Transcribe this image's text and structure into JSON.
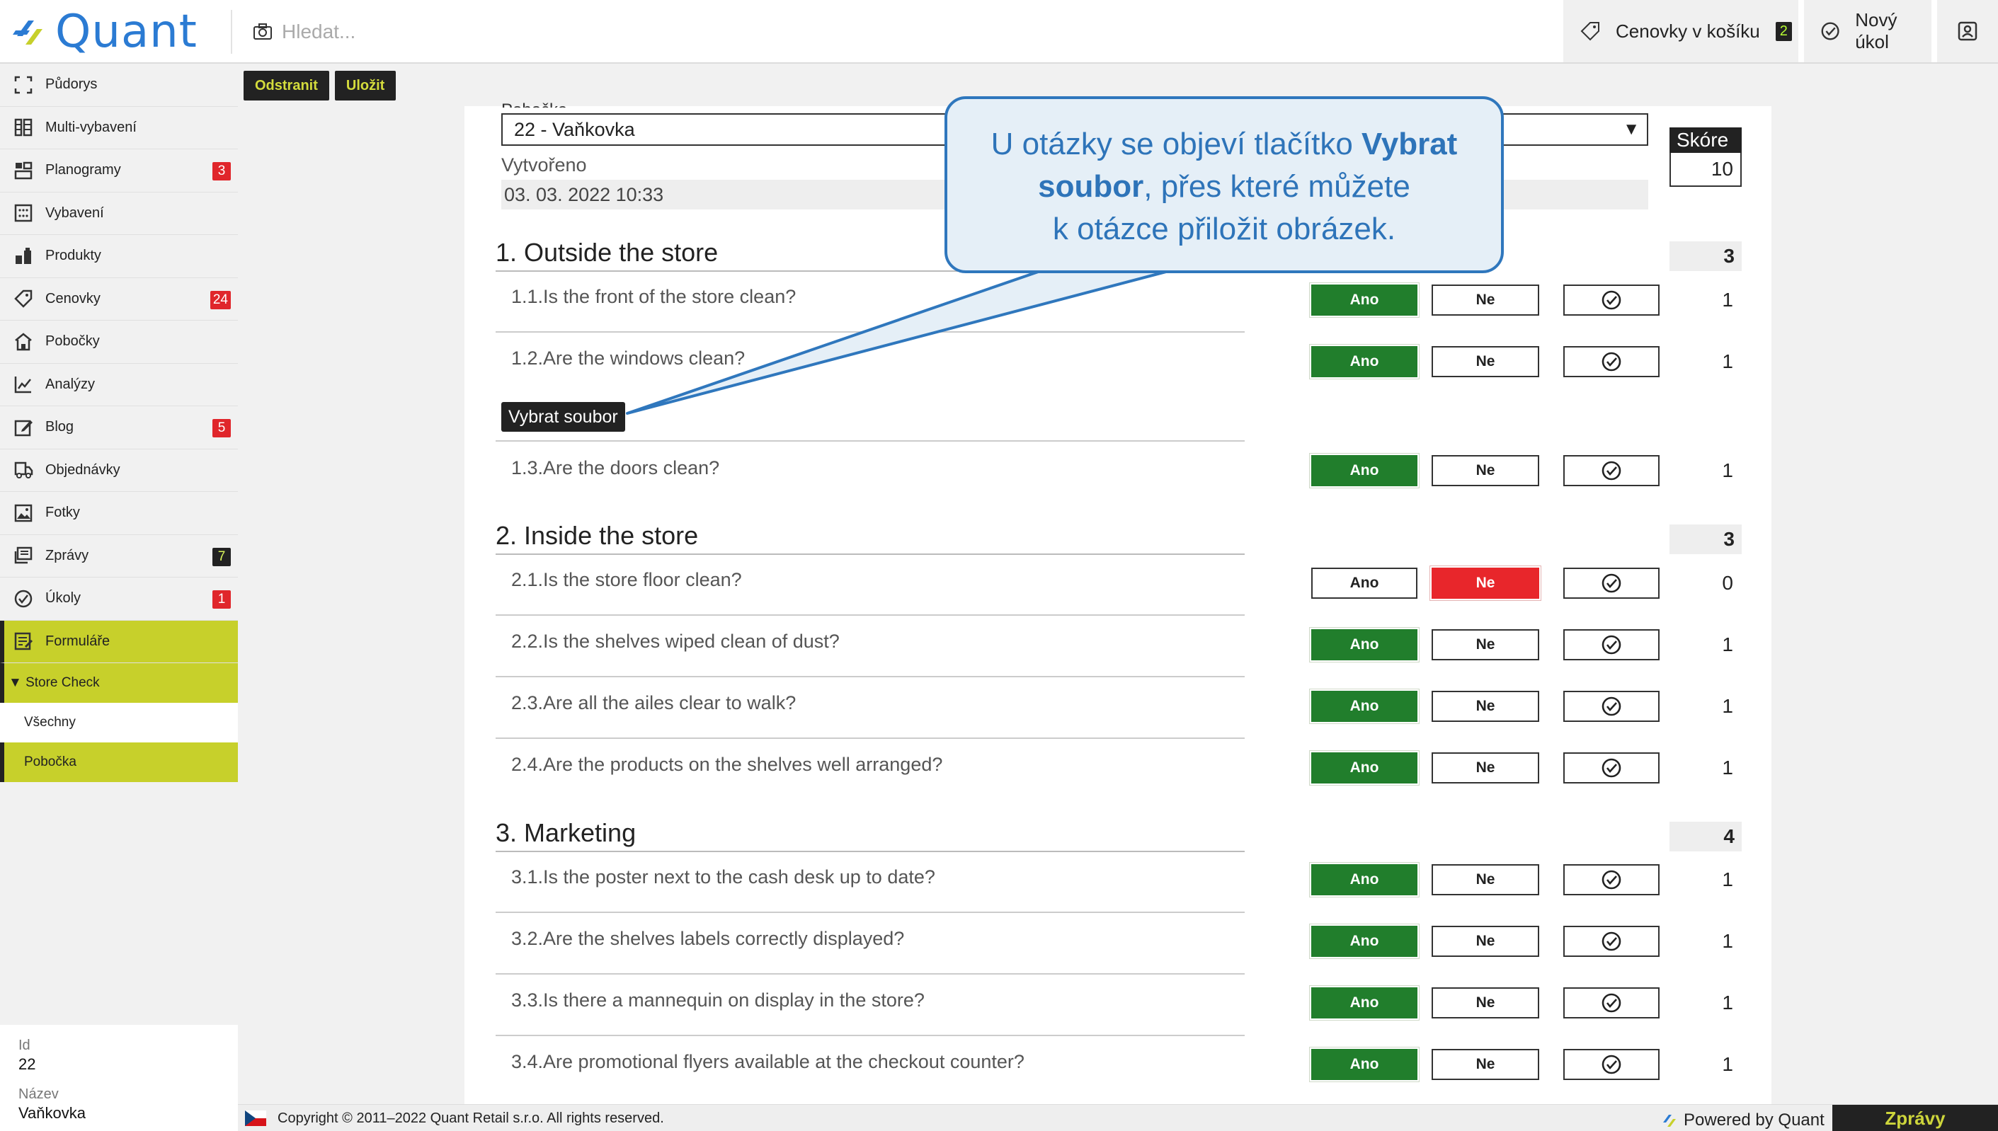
{
  "app": {
    "brand": "Quant",
    "brand_color": "#2b7bd3",
    "search_placeholder": "Hledat...",
    "top_buttons": [
      {
        "label": "Cenovky v košíku",
        "badge": "2",
        "icon": "tag-icon"
      },
      {
        "label": "Nový úkol",
        "icon": "check-circle-icon"
      },
      {
        "icon": "user-icon"
      }
    ]
  },
  "sidebar": {
    "items": [
      {
        "label": "Půdorys",
        "icon": "floorplan-icon"
      },
      {
        "label": "Multi-vybavení",
        "icon": "shelves-icon"
      },
      {
        "label": "Planogramy",
        "icon": "planogram-icon",
        "badge": "3"
      },
      {
        "label": "Vybavení",
        "icon": "grid-icon"
      },
      {
        "label": "Produkty",
        "icon": "products-icon"
      },
      {
        "label": "Cenovky",
        "icon": "tag-icon",
        "badge": "24"
      },
      {
        "label": "Pobočky",
        "icon": "store-icon"
      },
      {
        "label": "Analýzy",
        "icon": "chart-icon"
      },
      {
        "label": "Blog",
        "icon": "edit-icon",
        "badge": "5"
      },
      {
        "label": "Objednávky",
        "icon": "truck-icon"
      },
      {
        "label": "Fotky",
        "icon": "image-icon"
      },
      {
        "label": "Zprávy",
        "icon": "messages-icon",
        "badge": "7"
      },
      {
        "label": "Úkoly",
        "icon": "check-circle-icon",
        "badge": "1"
      },
      {
        "label": "Formuláře",
        "icon": "form-icon"
      }
    ],
    "group": "▼ Store Check",
    "sub_items": [
      "Všechny",
      "Pobočka"
    ],
    "info": {
      "id_label": "Id",
      "id_value": "22",
      "name_label": "Název",
      "name_value": "Vaňkovka"
    }
  },
  "toolbar": {
    "delete": "Odstranit",
    "save": "Uložit"
  },
  "form": {
    "branch_label": "Pobočka",
    "branch_value": "22 - Vaňkovka",
    "created_label": "Vytvořeno",
    "created_value": "03. 03. 2022 10:33",
    "score_label": "Skóre",
    "score_value": "10",
    "yes": "Ano",
    "no": "Ne",
    "file_button": "Vybrat soubor",
    "sections": [
      {
        "title": "1. Outside the store",
        "score": "3",
        "questions": [
          {
            "text": "1.1.Is the front of the store clean?",
            "answer": "Ano",
            "score": "1"
          },
          {
            "text": "1.2.Are the windows clean?",
            "answer": "Ano",
            "score": "1"
          },
          {
            "text": "1.3.Are the doors clean?",
            "answer": "Ano",
            "score": "1"
          }
        ]
      },
      {
        "title": "2. Inside the store",
        "score": "3",
        "questions": [
          {
            "text": "2.1.Is the store floor clean?",
            "answer": "Ne",
            "score": "0"
          },
          {
            "text": "2.2.Is the shelves wiped clean of dust?",
            "answer": "Ano",
            "score": "1"
          },
          {
            "text": "2.3.Are all the ailes clear to walk?",
            "answer": "Ano",
            "score": "1"
          },
          {
            "text": "2.4.Are the products on the shelves well arranged?",
            "answer": "Ano",
            "score": "1"
          }
        ]
      },
      {
        "title": "3. Marketing",
        "score": "4",
        "questions": [
          {
            "text": "3.1.Is the poster next to the cash desk up to date?",
            "answer": "Ano",
            "score": "1"
          },
          {
            "text": "3.2.Are the shelves labels correctly displayed?",
            "answer": "Ano",
            "score": "1"
          },
          {
            "text": "3.3.Is there a mannequin on display in the store?",
            "answer": "Ano",
            "score": "1"
          },
          {
            "text": "3.4.Are promotional flyers available at the checkout counter?",
            "answer": "Ano",
            "score": "1"
          }
        ]
      }
    ]
  },
  "callout": {
    "line1_pre": "U otázky se objeví tlačítko ",
    "line1_bold": "Vybrat",
    "line2_bold": "soubor",
    "line2_post": ", přes které můžete",
    "line3": "k otázce přiložit obrázek."
  },
  "footer": {
    "copyright": "Copyright © 2011–2022 Quant Retail s.r.o. All rights reserved.",
    "powered": "Powered by Quant",
    "messages": "Zprávy"
  },
  "colors": {
    "accent": "#c7d02b",
    "yes_green": "#217e2c",
    "no_red": "#e8262b",
    "callout_blue": "#2f77bd"
  }
}
